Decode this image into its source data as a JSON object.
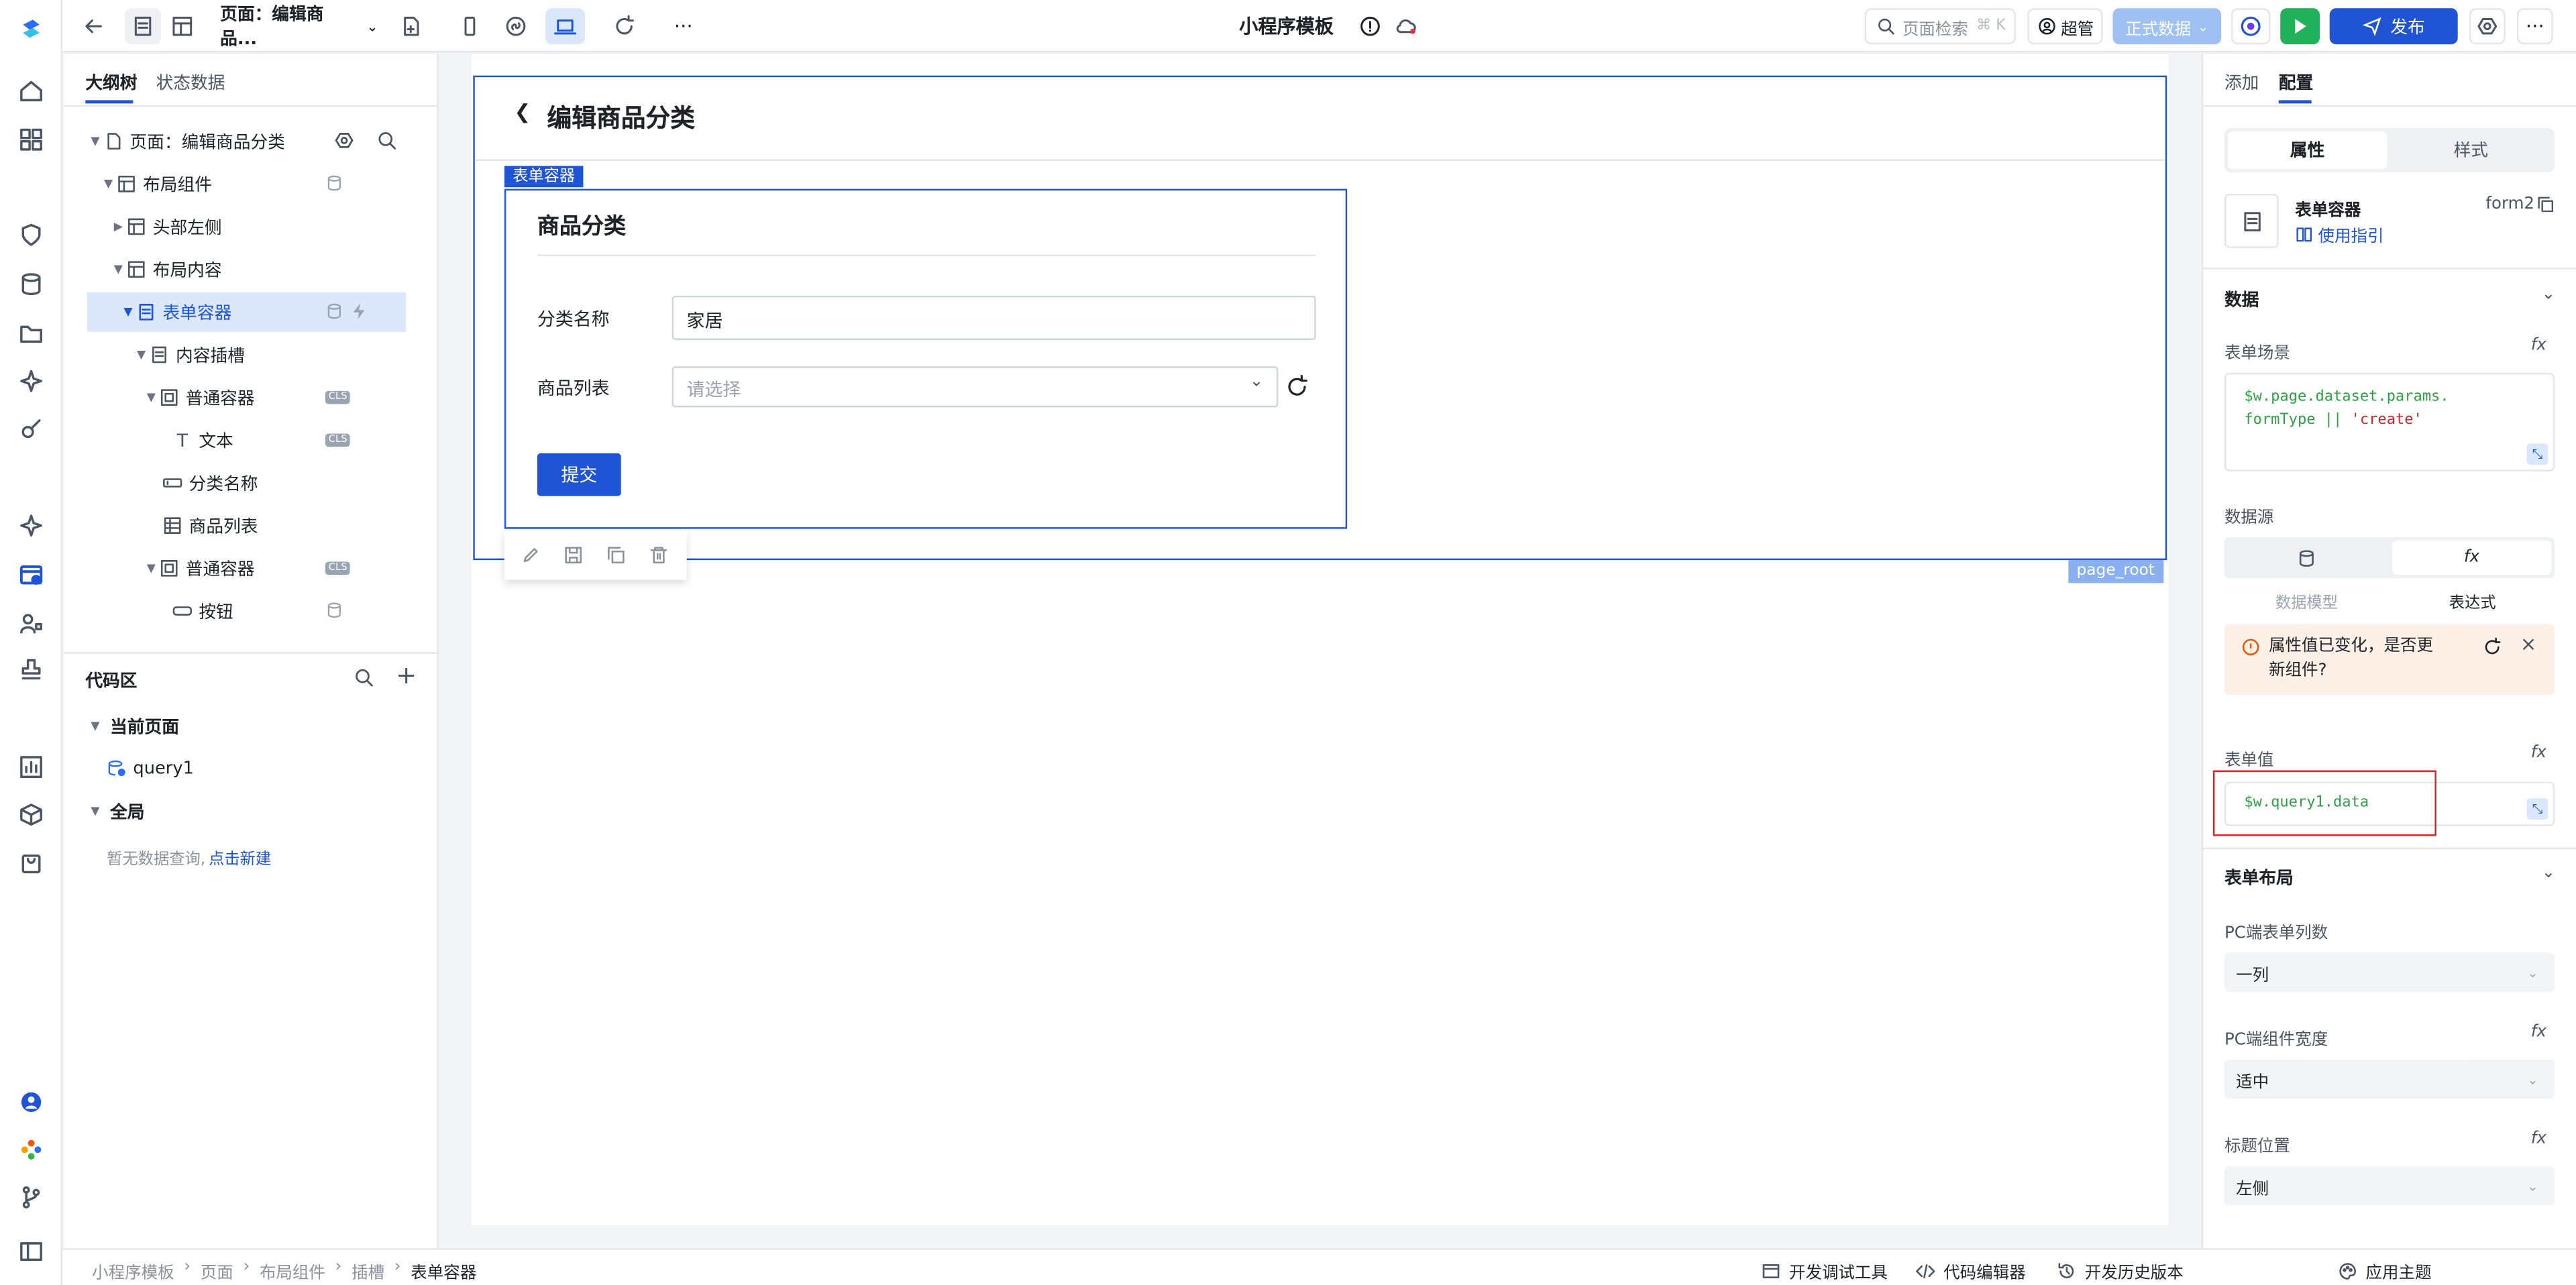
{
  "topbar": {
    "page_selector": "页面：编辑商品...",
    "app_title": "小程序模板",
    "search_placeholder": "页面检索",
    "search_shortcut": "⌘ K",
    "user": "超管",
    "env": "正式数据",
    "publish": "发布"
  },
  "left_panel": {
    "tabs": [
      "大纲树",
      "状态数据"
    ],
    "tree": [
      {
        "label": "页面：编辑商品分类"
      },
      {
        "label": "布局组件"
      },
      {
        "label": "头部左侧"
      },
      {
        "label": "布局内容"
      },
      {
        "label": "表单容器"
      },
      {
        "label": "内容插槽"
      },
      {
        "label": "普通容器"
      },
      {
        "label": "文本"
      },
      {
        "label": "分类名称"
      },
      {
        "label": "商品列表"
      },
      {
        "label": "普通容器"
      },
      {
        "label": "按钮"
      }
    ],
    "badge_cls": "CLS",
    "code_area": {
      "title": "代码区",
      "current_page": "当前页面",
      "query": "query1",
      "global": "全局",
      "empty_text": "暂无数据查询,",
      "create_link": "点击新建"
    }
  },
  "canvas": {
    "page_title": "编辑商品分类",
    "form_tag": "表单容器",
    "form_title": "商品分类",
    "field1_label": "分类名称",
    "field1_value": "家居",
    "field2_label": "商品列表",
    "field2_placeholder": "请选择",
    "submit": "提交",
    "root_tag": "page_root"
  },
  "right_panel": {
    "tabs": [
      "添加",
      "配置"
    ],
    "subtabs": [
      "属性",
      "样式"
    ],
    "component_name": "表单容器",
    "component_id": "form2",
    "guide_link": "使用指引",
    "data_section": "数据",
    "scene_label": "表单场景",
    "scene_code_1": "$w.page.dataset.params.",
    "scene_code_2": "formType || ",
    "scene_code_str": "'create'",
    "source_label": "数据源",
    "source_opts": [
      "数据模型",
      "表达式"
    ],
    "alert_text": "属性值已变化，是否更新组件?",
    "value_label": "表单值",
    "value_code": "$w.query1.data",
    "layout_section": "表单布局",
    "cols_label": "PC端表单列数",
    "cols_value": "一列",
    "width_label": "PC端组件宽度",
    "width_value": "适中",
    "title_pos_label": "标题位置",
    "title_pos_value": "左侧",
    "fx": "fx"
  },
  "bottom": {
    "breadcrumb": [
      "小程序模板",
      "页面",
      "布局组件",
      "插槽",
      "表单容器"
    ],
    "tools": [
      "开发调试工具",
      "代码编辑器",
      "开发历史版本",
      "应用主题"
    ]
  },
  "colors": {
    "accent": "#1f54d4",
    "selected_bg": "#dbe7fb",
    "highlight_box": "#e02020",
    "code_green": "#2f9e44",
    "code_red": "#c92a2a"
  }
}
